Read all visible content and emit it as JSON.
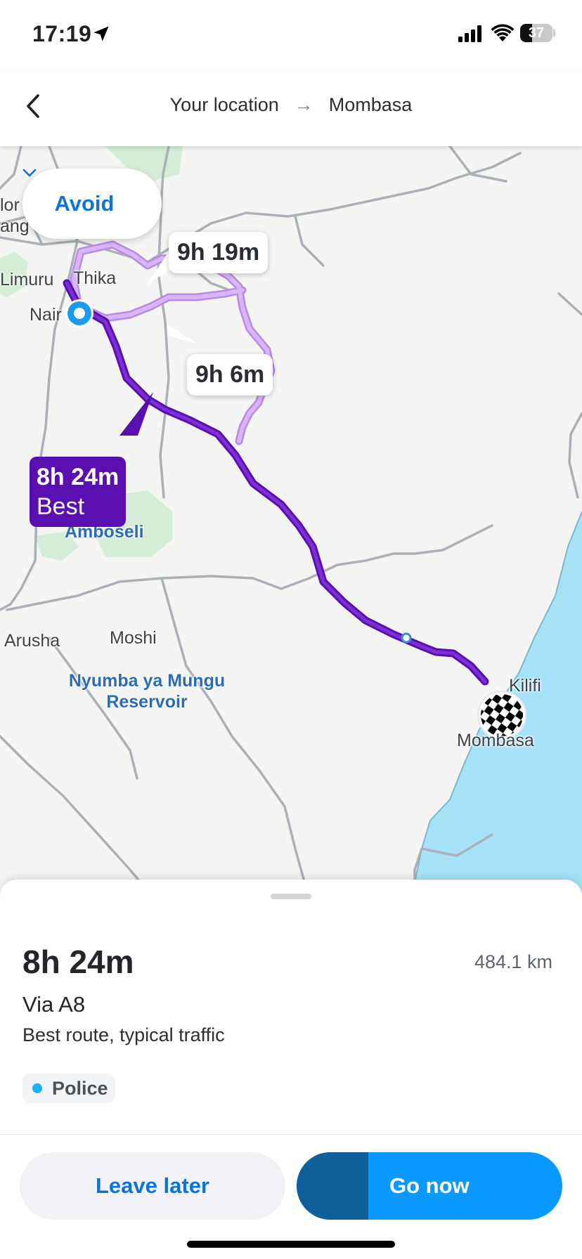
{
  "status_bar": {
    "time": "17:19",
    "battery_percent": "37",
    "battery_level": 0.37,
    "icons": [
      "location-arrow-icon",
      "cellular-signal-icon",
      "wifi-icon",
      "battery-icon"
    ]
  },
  "header": {
    "origin": "Your location",
    "arrow": "→",
    "destination": "Mombasa",
    "back_icon": "chevron-left-icon"
  },
  "map": {
    "avoid_label": "Avoid",
    "avoid_icon": "chevron-down-icon",
    "labels": {
      "nor": "lor",
      "mang": "ang",
      "limuru": "Limuru",
      "thika": "Thika",
      "nairobi": "Nair",
      "amboseli": "Amboseli",
      "arusha": "Arusha",
      "moshi": "Moshi",
      "reservoir_line1": "Nyumba ya Mungu",
      "reservoir_line2": "Reservoir",
      "kilifi": "Kilifi",
      "mombasa": "Mombasa"
    },
    "routes": [
      {
        "duration": "9h 19m",
        "selected": false
      },
      {
        "duration": "9h 6m",
        "selected": false
      },
      {
        "duration": "8h 24m",
        "tag": "Best",
        "selected": true
      }
    ],
    "colors": {
      "best_route": "#5a0fb0",
      "alt_route": "#c9a0f2",
      "water": "#a6e3f9",
      "park": "#d5edd6"
    }
  },
  "sheet": {
    "duration": "8h 24m",
    "distance": "484.1 km",
    "via": "Via A8",
    "description": "Best route, typical traffic",
    "chip_label": "Police",
    "leave_later": "Leave later",
    "go_now": "Go now",
    "go_now_progress": 0.27
  }
}
